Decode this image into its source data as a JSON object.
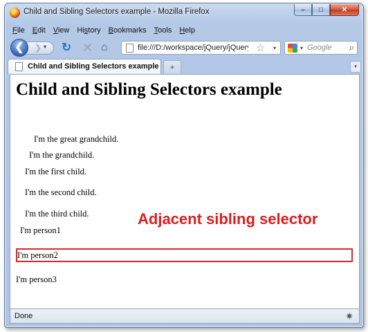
{
  "window": {
    "title": "Child and Sibling Selectors example - Mozilla Firefox",
    "controls": {
      "minimize": "–",
      "maximize": "□",
      "close": "✕"
    }
  },
  "menu": {
    "items": [
      {
        "accel": "F",
        "rest": "ile"
      },
      {
        "accel": "E",
        "rest": "dit"
      },
      {
        "accel": "V",
        "rest": "iew"
      },
      {
        "pre": "Hi",
        "accel": "s",
        "rest": "tory"
      },
      {
        "accel": "B",
        "rest": "ookmarks"
      },
      {
        "accel": "T",
        "rest": "ools"
      },
      {
        "accel": "H",
        "rest": "elp"
      }
    ]
  },
  "toolbar": {
    "url": "file:///D:/workspace/jQuery/jQuery-ge",
    "search_placeholder": "Google",
    "icons": {
      "back": "❮",
      "forward": "❯",
      "dropdown": "▾",
      "reload": "↻",
      "stop": "✕",
      "home": "⌂",
      "star": "☆",
      "magnifier": "⌕"
    }
  },
  "tabs": {
    "active_label": "Child and Sibling Selectors example",
    "new_tab": "+",
    "list_tabs": "▾"
  },
  "page": {
    "heading": "Child and Sibling Selectors example",
    "lines": {
      "great_grandchild": "I'm the great grandchild.",
      "grandchild": "I'm the grandchild.",
      "first_child": "I'm the first child.",
      "second_child": "I'm the second child.",
      "third_child": "I'm the third child.",
      "person1": "I'm person1",
      "person2": "I'm person2",
      "person3": "I'm person3"
    },
    "annotation": "Adjacent sibling selector",
    "annotation_color": "#dd1d1d",
    "highlight_color": "#d8282b"
  },
  "status": {
    "text": "Done",
    "grip_icon": "✷"
  }
}
